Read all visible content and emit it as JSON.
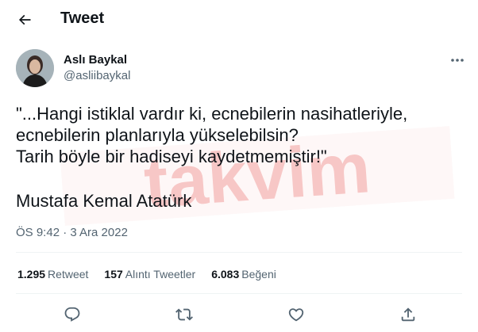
{
  "header": {
    "back_icon": "arrow-left-icon",
    "title": "Tweet"
  },
  "author": {
    "name": "Aslı Baykal",
    "handle": "@asliibaykal"
  },
  "more_icon": "ellipsis-icon",
  "tweet": {
    "text": "\"...Hangi istiklal vardır ki, ecnebilerin nasihatleriyle,\necnebilerin planlarıyla yükselebilsin?\nTarih böyle bir hadiseyi kaydetmemiştir!\"",
    "signature": "Mustafa Kemal Atatürk"
  },
  "watermark": {
    "text": "takvim",
    "color": "#e53935"
  },
  "meta": {
    "datetime": "ÖS 9:42 · 3 Ara 2022"
  },
  "stats": [
    {
      "count": "1.295",
      "label": "Retweet"
    },
    {
      "count": "157",
      "label": "Alıntı Tweetler"
    },
    {
      "count": "6.083",
      "label": "Beğeni"
    }
  ],
  "actions": [
    {
      "icon": "reply-icon"
    },
    {
      "icon": "retweet-icon"
    },
    {
      "icon": "like-icon"
    },
    {
      "icon": "share-icon"
    }
  ],
  "colors": {
    "text_primary": "#0f1419",
    "text_secondary": "#536471",
    "divider": "#eff3f4"
  }
}
